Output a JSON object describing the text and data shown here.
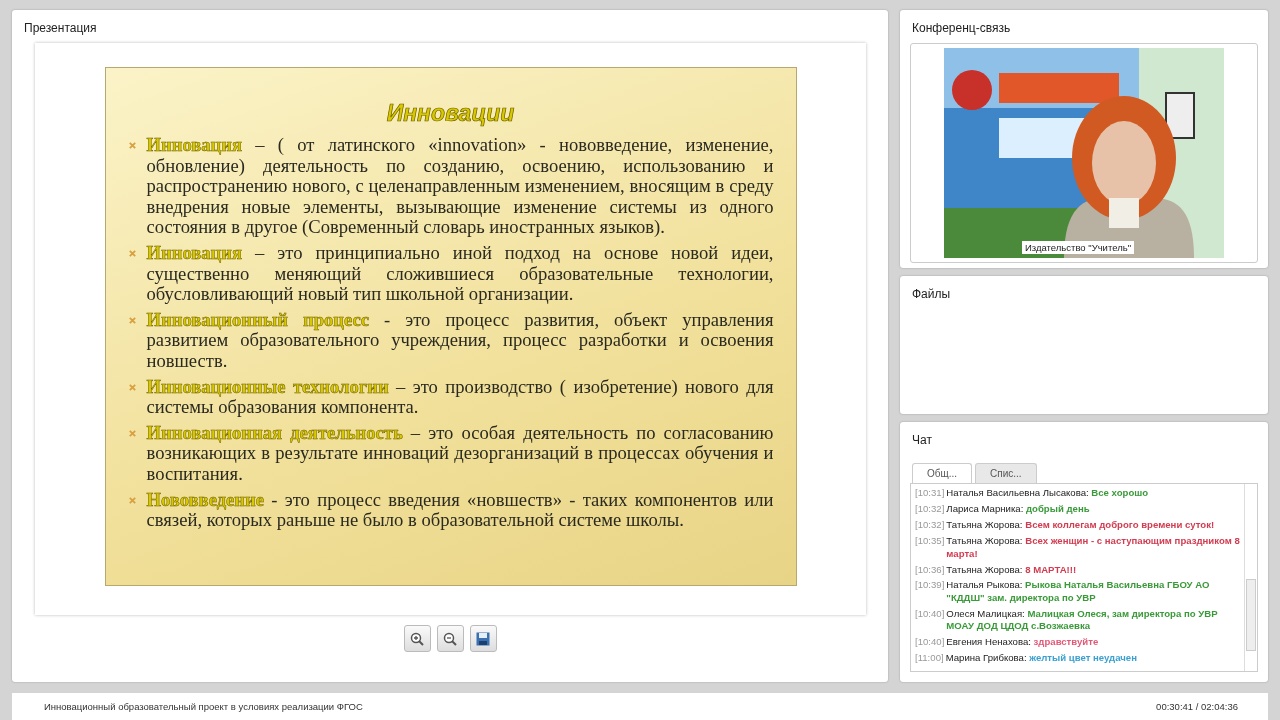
{
  "presentation": {
    "title": "Презентация",
    "slide": {
      "heading": "Инновации",
      "items": [
        {
          "term": "Инновация",
          "text": "– ( от латинского «innovation» - нововведение, изменение,  обновление) деятельность по созданию, освоению, использованию и распространению нового, с целенаправленным изменением, вносящим в среду внедрения новые элементы, вызывающие изменение системы из одного состояния в другое (Современный словарь иностранных языков)."
        },
        {
          "term": "Инновация",
          "text": "– это принципиально иной подход на основе новой идеи, существенно меняющий сложившиеся образовательные технологии, обусловливающий новый тип школьной организации."
        },
        {
          "term": "Инновационный процесс",
          "text": "- это процесс развития, объект управления развитием образовательного учреждения, процесс разработки и освоения новшеств."
        },
        {
          "term": "Инновационные технологии",
          "text": "– это производство ( изобретение) нового для системы образования компонента."
        },
        {
          "term": "Инновационная деятельность",
          "text": "– это особая деятельность по согласованию возникающих в результате инноваций дезорганизаций в процессах обучения и воспитания."
        },
        {
          "term": "Нововведение",
          "text": "- это процесс введения «новшеств» - таких компонентов или связей, которых раньше не было в образовательной системе школы."
        }
      ]
    }
  },
  "conference": {
    "title": "Конференц-связь",
    "caption": "Издательство \"Учитель\""
  },
  "files": {
    "title": "Файлы"
  },
  "chat": {
    "title": "Чат",
    "tabs": [
      {
        "label": "Общ...",
        "selected": true
      },
      {
        "label": "Спис...",
        "selected": false
      }
    ],
    "messages": [
      {
        "time": "[10:31]",
        "name": "Наталья Васильевна Лысакова:",
        "text": "Все хорошо",
        "color": "#3a9a3a"
      },
      {
        "time": "[10:32]",
        "name": "Лариса Марника:",
        "text": "добрый день",
        "color": "#3a9a3a"
      },
      {
        "time": "[10:32]",
        "name": "Татьяна Жорова:",
        "text": "Всем коллегам доброго времени суток!",
        "color": "#d23c50"
      },
      {
        "time": "[10:35]",
        "name": "Татьяна Жорова:",
        "text": "Всех женщин - с наступающим праздником 8 марта!",
        "color": "#d23c50"
      },
      {
        "time": "[10:36]",
        "name": "Татьяна Жорова:",
        "text": "8 МАРТА!!!",
        "color": "#d23c50"
      },
      {
        "time": "[10:39]",
        "name": "Наталья Рыкова:",
        "text": "Рыкова Наталья Васильевна ГБОУ АО \"КДДШ\" зам. директора по УВР",
        "color": "#3a9a3a"
      },
      {
        "time": "[10:40]",
        "name": "Олеся Малицкая:",
        "text": "Малицкая Олеся, зам директора по УВР МОАУ ДОД ЦДОД с.Возжаевка",
        "color": "#3a9a3a"
      },
      {
        "time": "[10:40]",
        "name": "Евгения Ненахова:",
        "text": "здравствуйте",
        "color": "#e05a78"
      },
      {
        "time": "[11:00]",
        "name": "Марина Грибкова:",
        "text": "желтый цвет неудачен",
        "color": "#3aa0d0"
      }
    ]
  },
  "footer": {
    "title": "Инновационный образовательный проект в условиях реализации ФГОС",
    "time": "00:30:41 / 02:04:36"
  }
}
